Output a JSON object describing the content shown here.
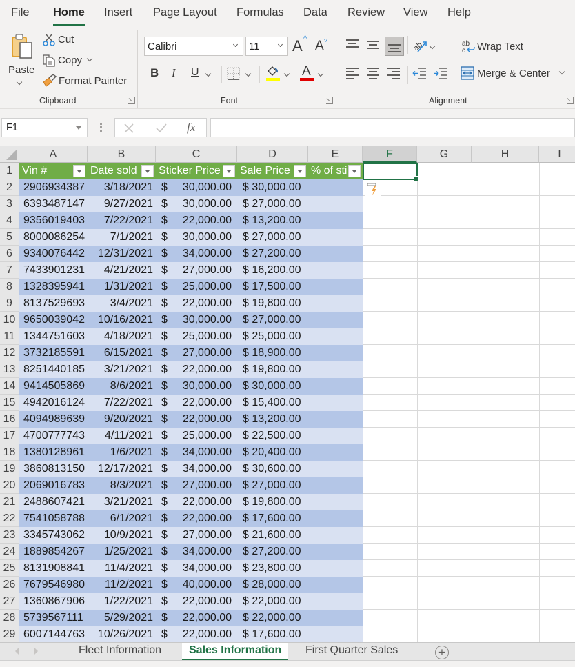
{
  "menu": {
    "tabs": [
      "File",
      "Home",
      "Insert",
      "Page Layout",
      "Formulas",
      "Data",
      "Review",
      "View",
      "Help"
    ],
    "active_tab": "Home"
  },
  "ribbon": {
    "clipboard": {
      "label": "Clipboard",
      "paste": "Paste",
      "cut": "Cut",
      "copy": "Copy",
      "format_painter": "Format Painter"
    },
    "font": {
      "label": "Font",
      "font_name": "Calibri",
      "font_size": "11",
      "bold": "B",
      "italic": "I",
      "underline": "U",
      "increase_size": "A",
      "decrease_size": "A",
      "font_color_letter": "A",
      "highlight_color": "#ffff00",
      "font_color": "#e00000"
    },
    "alignment": {
      "label": "Alignment",
      "wrap_text": "Wrap Text",
      "merge_center": "Merge & Center"
    }
  },
  "formula_bar": {
    "name_box": "F1",
    "fx_label": "fx",
    "formula": ""
  },
  "grid": {
    "columns": [
      "A",
      "B",
      "C",
      "D",
      "E",
      "F",
      "G",
      "H",
      "I"
    ],
    "selected_column": "F",
    "selected_cell": "F1",
    "headers": [
      "Vin #",
      "Date sold",
      "Sticker Price",
      "Sale Price",
      "% of sti"
    ],
    "rows": [
      {
        "n": "2",
        "vin": "2906934387",
        "date": "3/18/2021",
        "sticker": "30,000.00",
        "sale": "$ 30,000.00"
      },
      {
        "n": "3",
        "vin": "6393487147",
        "date": "9/27/2021",
        "sticker": "30,000.00",
        "sale": "$ 27,000.00"
      },
      {
        "n": "4",
        "vin": "9356019403",
        "date": "7/22/2021",
        "sticker": "22,000.00",
        "sale": "$ 13,200.00"
      },
      {
        "n": "5",
        "vin": "8000086254",
        "date": "7/1/2021",
        "sticker": "30,000.00",
        "sale": "$ 27,000.00"
      },
      {
        "n": "6",
        "vin": "9340076442",
        "date": "12/31/2021",
        "sticker": "34,000.00",
        "sale": "$ 27,200.00"
      },
      {
        "n": "7",
        "vin": "7433901231",
        "date": "4/21/2021",
        "sticker": "27,000.00",
        "sale": "$ 16,200.00"
      },
      {
        "n": "8",
        "vin": "1328395941",
        "date": "1/31/2021",
        "sticker": "25,000.00",
        "sale": "$ 17,500.00"
      },
      {
        "n": "9",
        "vin": "8137529693",
        "date": "3/4/2021",
        "sticker": "22,000.00",
        "sale": "$ 19,800.00"
      },
      {
        "n": "10",
        "vin": "9650039042",
        "date": "10/16/2021",
        "sticker": "30,000.00",
        "sale": "$ 27,000.00"
      },
      {
        "n": "11",
        "vin": "1344751603",
        "date": "4/18/2021",
        "sticker": "25,000.00",
        "sale": "$ 25,000.00"
      },
      {
        "n": "12",
        "vin": "3732185591",
        "date": "6/15/2021",
        "sticker": "27,000.00",
        "sale": "$ 18,900.00"
      },
      {
        "n": "13",
        "vin": "8251440185",
        "date": "3/21/2021",
        "sticker": "22,000.00",
        "sale": "$ 19,800.00"
      },
      {
        "n": "14",
        "vin": "9414505869",
        "date": "8/6/2021",
        "sticker": "30,000.00",
        "sale": "$ 30,000.00"
      },
      {
        "n": "15",
        "vin": "4942016124",
        "date": "7/22/2021",
        "sticker": "22,000.00",
        "sale": "$ 15,400.00"
      },
      {
        "n": "16",
        "vin": "4094989639",
        "date": "9/20/2021",
        "sticker": "22,000.00",
        "sale": "$ 13,200.00"
      },
      {
        "n": "17",
        "vin": "4700777743",
        "date": "4/11/2021",
        "sticker": "25,000.00",
        "sale": "$ 22,500.00"
      },
      {
        "n": "18",
        "vin": "1380128961",
        "date": "1/6/2021",
        "sticker": "34,000.00",
        "sale": "$ 20,400.00"
      },
      {
        "n": "19",
        "vin": "3860813150",
        "date": "12/17/2021",
        "sticker": "34,000.00",
        "sale": "$ 30,600.00"
      },
      {
        "n": "20",
        "vin": "2069016783",
        "date": "8/3/2021",
        "sticker": "27,000.00",
        "sale": "$ 27,000.00"
      },
      {
        "n": "21",
        "vin": "2488607421",
        "date": "3/21/2021",
        "sticker": "22,000.00",
        "sale": "$ 19,800.00"
      },
      {
        "n": "22",
        "vin": "7541058788",
        "date": "6/1/2021",
        "sticker": "22,000.00",
        "sale": "$ 17,600.00"
      },
      {
        "n": "23",
        "vin": "3345743062",
        "date": "10/9/2021",
        "sticker": "27,000.00",
        "sale": "$ 21,600.00"
      },
      {
        "n": "24",
        "vin": "1889854267",
        "date": "1/25/2021",
        "sticker": "34,000.00",
        "sale": "$ 27,200.00"
      },
      {
        "n": "25",
        "vin": "8131908841",
        "date": "11/4/2021",
        "sticker": "34,000.00",
        "sale": "$ 23,800.00"
      },
      {
        "n": "26",
        "vin": "7679546980",
        "date": "11/2/2021",
        "sticker": "40,000.00",
        "sale": "$ 28,000.00"
      },
      {
        "n": "27",
        "vin": "1360867906",
        "date": "1/22/2021",
        "sticker": "22,000.00",
        "sale": "$ 22,000.00"
      },
      {
        "n": "28",
        "vin": "5739567111",
        "date": "5/29/2021",
        "sticker": "22,000.00",
        "sale": "$ 22,000.00"
      },
      {
        "n": "29",
        "vin": "6007144763",
        "date": "10/26/2021",
        "sticker": "22,000.00",
        "sale": "$ 17,600.00"
      }
    ],
    "currency_symbol": "$",
    "header_color": "#70ad47",
    "band_dark": "#b4c6e7",
    "band_light": "#d9e1f2",
    "accent": "#217346"
  },
  "sheets": {
    "tabs": [
      "Fleet Information",
      "Sales Information",
      "First Quarter Sales"
    ],
    "active": "Sales Information"
  }
}
